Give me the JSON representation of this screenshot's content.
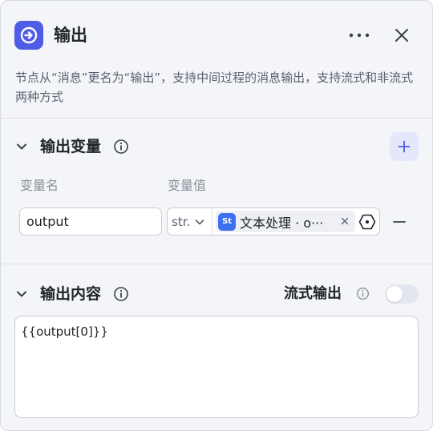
{
  "header": {
    "title": "输出",
    "description": "节点从“消息”更名为“输出”，支持中间过程的消息输出，支持流式和非流式两种方式",
    "icon": "output-arrow-icon",
    "accent_color": "#4e5ce6"
  },
  "output_variables": {
    "title": "输出变量",
    "col_name_label": "变量名",
    "col_value_label": "变量值",
    "rows": [
      {
        "name": "output",
        "type": "str.",
        "ref_badge": "St",
        "ref_text": "文本处理 · o···"
      }
    ]
  },
  "output_content": {
    "title": "输出内容",
    "stream_label": "流式输出",
    "stream_enabled": false,
    "content": "{{output[0]}}"
  }
}
